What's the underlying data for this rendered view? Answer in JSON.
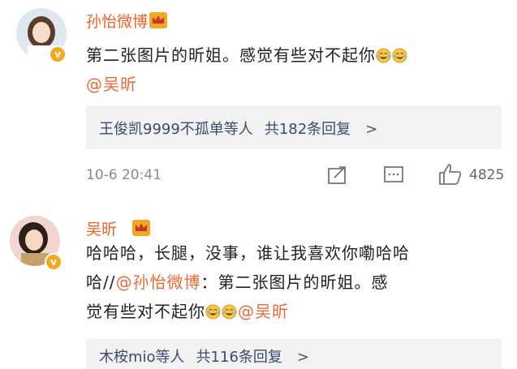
{
  "comments": [
    {
      "name": "孙怡微博",
      "text": "第二张图片的昕姐。感觉有些对不起你",
      "mention": "@吴昕",
      "replies": {
        "users": "王俊凯9999不孤单等人",
        "count": "共182条回复",
        "chevron": ">"
      },
      "time": "10-6 20:41",
      "likes": "4825",
      "colors": {
        "avatar_bg": "#d9e2ec",
        "hair": "#5a3b2c",
        "skin": "#f6dccb"
      }
    },
    {
      "name": "吴昕",
      "text_line1": "哈哈哈，长腿，没事，谁让我喜欢你嘞哈哈",
      "text_line2_prefix": "哈//",
      "mention_repost": "@孙怡微博",
      "text_line2_suffix": "：第二张图片的昕姐。感",
      "text_line3": "觉有些对不起你",
      "mention": "@吴昕",
      "replies": {
        "users": "木桉mio等人",
        "count": "共116条回复",
        "chevron": ">"
      },
      "colors": {
        "avatar_bg": "#f4d7d0",
        "hair": "#2f1f1a",
        "skin": "#f7d8c4"
      }
    }
  ],
  "icons": [
    "verified-badge-icon",
    "crown-icon",
    "laugh-cry-emoji-icon",
    "share-icon",
    "comment-icon",
    "like-icon",
    "chevron-right-icon"
  ],
  "accent": {
    "name": "#e8632b",
    "mention": "#ea6b38",
    "reply_link": "#3b4a72",
    "verified": "#f5a623"
  }
}
